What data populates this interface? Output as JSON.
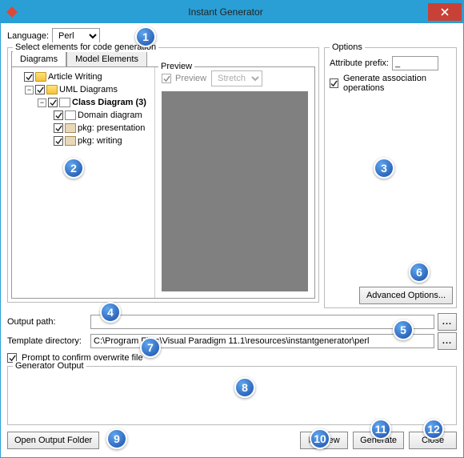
{
  "window": {
    "title": "Instant Generator"
  },
  "language": {
    "label": "Language:",
    "value": "Perl"
  },
  "selectElements": {
    "legend": "Select elements for code generation",
    "tabs": {
      "diagrams": "Diagrams",
      "modelElements": "Model Elements"
    },
    "tree": [
      {
        "label": "Article Writing",
        "indent": 0,
        "icon": "folder",
        "checked": true,
        "expander": "none"
      },
      {
        "label": "UML Diagrams",
        "indent": 1,
        "icon": "folder",
        "checked": true,
        "expander": "minus"
      },
      {
        "label": "Class Diagram (3)",
        "indent": 2,
        "icon": "diagram",
        "checked": true,
        "expander": "minus",
        "bold": true
      },
      {
        "label": "Domain diagram",
        "indent": 3,
        "icon": "diagram",
        "checked": true,
        "expander": "none"
      },
      {
        "label": "pkg: presentation",
        "indent": 3,
        "icon": "pkg",
        "checked": true,
        "expander": "none"
      },
      {
        "label": "pkg: writing",
        "indent": 3,
        "icon": "pkg",
        "checked": true,
        "expander": "none"
      }
    ]
  },
  "preview": {
    "legend": "Preview",
    "checkbox": "Preview",
    "mode": "Stretch"
  },
  "options": {
    "legend": "Options",
    "attrPrefix": {
      "label": "Attribute prefix:",
      "value": "_"
    },
    "genAssoc": {
      "label": "Generate association operations",
      "checked": true
    },
    "advanced": "Advanced Options..."
  },
  "outputPath": {
    "label": "Output path:",
    "value": "",
    "browse": "..."
  },
  "templateDir": {
    "label": "Template directory:",
    "value": "C:\\Program Files\\Visual Paradigm 11.1\\resources\\instantgenerator\\perl",
    "browse": "..."
  },
  "prompt": {
    "label": "Prompt to confirm overwrite file",
    "checked": true
  },
  "generatorOutput": {
    "legend": "Generator Output"
  },
  "buttons": {
    "openOutput": "Open Output Folder",
    "preview": "Preview",
    "generate": "Generate",
    "close": "Close"
  },
  "callouts": [
    "1",
    "2",
    "3",
    "4",
    "5",
    "6",
    "7",
    "8",
    "9",
    "10",
    "11",
    "12"
  ]
}
